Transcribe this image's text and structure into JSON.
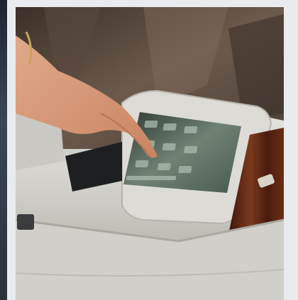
{
  "photo": {
    "subject": "rear-seat-armrest-touchscreen",
    "colors": {
      "leather": "#d9d8d2",
      "leather_shadow": "#a9a8a1",
      "screen": "#5f6f62",
      "wood": "#5a2414",
      "background": "#6e5f52"
    }
  }
}
